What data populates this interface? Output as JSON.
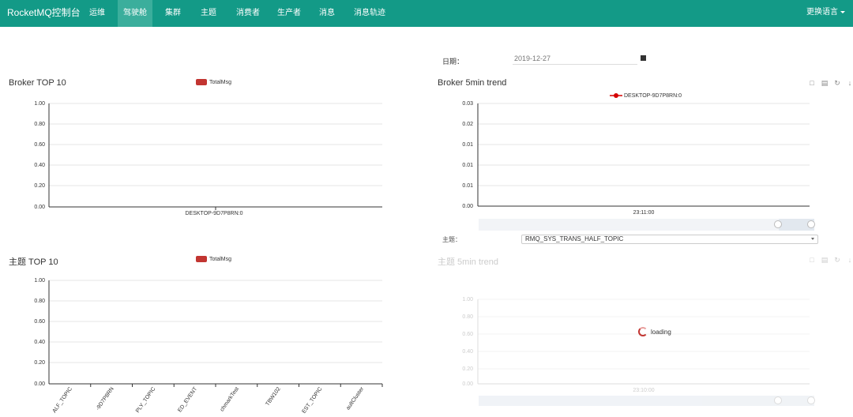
{
  "nav": {
    "brand": "RocketMQ控制台",
    "items": [
      {
        "label": "运维"
      },
      {
        "label": "驾驶舱"
      },
      {
        "label": "集群"
      },
      {
        "label": "主题"
      },
      {
        "label": "消费者"
      },
      {
        "label": "生产者"
      },
      {
        "label": "消息"
      },
      {
        "label": "消息轨迹"
      }
    ],
    "active": "驾驶舱",
    "language": "更换语言"
  },
  "date": {
    "label": "日期：",
    "value": "2019-12-27"
  },
  "topic_selector": {
    "label": "主题：",
    "value": "RMQ_SYS_TRANS_HALF_TOPIC"
  },
  "panels": {
    "broker_top": {
      "title": "Broker TOP 10"
    },
    "broker_trend": {
      "title": "Broker 5min trend"
    },
    "topic_top": {
      "title": "主题 TOP 10"
    },
    "topic_trend": {
      "title": "主题 5min trend",
      "loading_text": "loading"
    }
  },
  "toolbox_icons": [
    "zoom-icon",
    "zoom-reset-icon",
    "restore-icon",
    "save-image-icon"
  ],
  "colors": {
    "nav": "#139a87",
    "nav_active": "#3bae9c",
    "series": "#c23531"
  },
  "chart_data": [
    {
      "type": "bar",
      "title": "Broker TOP 10",
      "categories": [
        "DESKTOP-9D7P8RN:0"
      ],
      "series": [
        {
          "name": "TotalMsg",
          "values": [
            0
          ]
        }
      ],
      "yticks": [
        "1.00",
        "0.80",
        "0.60",
        "0.40",
        "0.20",
        "0.00"
      ],
      "ylim": [
        0,
        1
      ],
      "grid": true,
      "legend": "top-center"
    },
    {
      "type": "line",
      "title": "Broker 5min trend",
      "x": [
        "23:11:00"
      ],
      "series": [
        {
          "name": "DESKTOP-9D7P8RN:0",
          "values": [
            0
          ]
        }
      ],
      "yticks": [
        "0.03",
        "0.02",
        "0.01",
        "0.01",
        "0.01",
        "0.00"
      ],
      "grid": true,
      "legend": "top-center"
    },
    {
      "type": "bar",
      "title": "主题 TOP 10",
      "categories": [
        "ALF_TOPIC",
        "-9D7P8RN",
        "PLY_TOPIC",
        "ED_EVENT",
        "chmarkTest",
        "TBW102",
        "EST_TOPIC",
        "aultCluster"
      ],
      "series": [
        {
          "name": "TotalMsg",
          "values": [
            0,
            0,
            0,
            0,
            0,
            0,
            0,
            0
          ]
        }
      ],
      "yticks": [
        "1.00",
        "0.80",
        "0.60",
        "0.40",
        "0.20",
        "0.00"
      ],
      "ylim": [
        0,
        1
      ],
      "grid": true,
      "legend": "top-center"
    },
    {
      "type": "line",
      "title": "主题 5min trend",
      "x": [
        "23:10:00"
      ],
      "series": [],
      "yticks": [
        "1.00",
        "0.80",
        "0.60",
        "0.40",
        "0.20",
        "0.00"
      ],
      "ylim": [
        0,
        1
      ],
      "grid": true,
      "legend": "none"
    }
  ]
}
